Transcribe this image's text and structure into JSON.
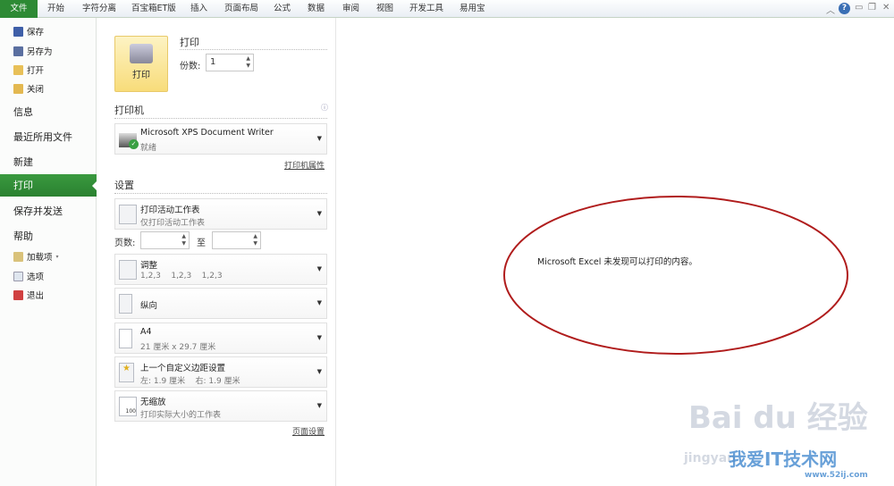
{
  "ribbon": {
    "tabs": [
      "文件",
      "开始",
      "字符分离",
      "百宝箱ET版",
      "插入",
      "页面布局",
      "公式",
      "数据",
      "审阅",
      "视图",
      "开发工具",
      "易用宝"
    ]
  },
  "sidebar": {
    "top": [
      "保存",
      "另存为",
      "打开",
      "关闭"
    ],
    "sections": [
      "信息",
      "最近所用文件",
      "新建",
      "打印",
      "保存并发送",
      "帮助"
    ],
    "bottom": [
      "加载项",
      "选项",
      "退出"
    ]
  },
  "print": {
    "button": "打印",
    "heading": "打印",
    "copies_label": "份数:",
    "copies_value": "1"
  },
  "printer": {
    "heading": "打印机",
    "name": "Microsoft XPS Document Writer",
    "status": "就绪",
    "properties_link": "打印机属性"
  },
  "settings": {
    "heading": "设置",
    "pages_label": "页数:",
    "to_label": "至",
    "page_setup_link": "页面设置",
    "dropdowns": [
      {
        "title": "打印活动工作表",
        "sub": "仅打印活动工作表"
      },
      {
        "title": "调整",
        "sub": "1,2,3    1,2,3    1,2,3"
      },
      {
        "title": "纵向",
        "sub": ""
      },
      {
        "title": "A4",
        "sub": "21 厘米 x 29.7 厘米"
      },
      {
        "title": "上一个自定义边距设置",
        "sub": "左: 1.9 厘米    右: 1.9 厘米"
      },
      {
        "title": "无缩放",
        "sub": "打印实际大小的工作表"
      }
    ]
  },
  "preview": {
    "message": "Microsoft Excel 未发现可以打印的内容。"
  },
  "watermark": {
    "baidu": "Bai du 经验",
    "jingyan": "jingyan",
    "site": "我爱IT技术网",
    "url": "www.52ij.com"
  },
  "colors": {
    "accent": "#2d8a34",
    "annotation": "#b01c1c"
  }
}
